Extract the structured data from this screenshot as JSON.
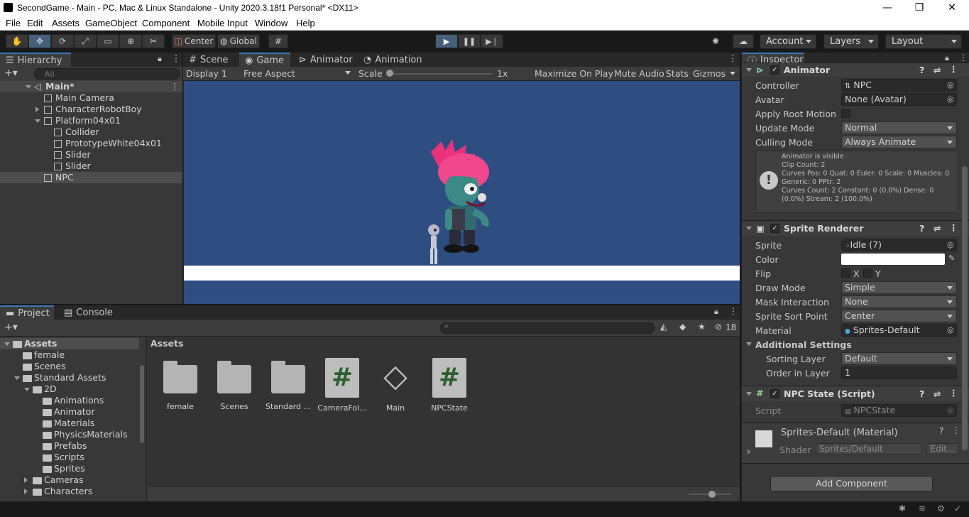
{
  "window": {
    "title": "SecondGame - Main - PC, Mac & Linux Standalone - Unity 2020.3.18f1 Personal* <DX11>",
    "minimize": "—",
    "maximize": "❐",
    "close": "✕"
  },
  "menu": [
    "File",
    "Edit",
    "Assets",
    "GameObject",
    "Component",
    "Mobile Input",
    "Window",
    "Help"
  ],
  "toolbar": {
    "pivot": "Center",
    "space": "Global",
    "account": "Account",
    "layers": "Layers",
    "layout": "Layout"
  },
  "hierarchy": {
    "tab": "Hierarchy",
    "search_placeholder": "All",
    "items": [
      {
        "label": "Main*"
      },
      {
        "label": "Main Camera"
      },
      {
        "label": "CharacterRobotBoy"
      },
      {
        "label": "Platform04x01"
      },
      {
        "label": "Collider"
      },
      {
        "label": "PrototypeWhite04x01"
      },
      {
        "label": "Slider"
      },
      {
        "label": "Slider"
      },
      {
        "label": "NPC"
      }
    ]
  },
  "game_tabs": {
    "scene": "Scene",
    "game": "Game",
    "animator": "Animator",
    "animation": "Animation"
  },
  "game_bar": {
    "display": "Display 1",
    "aspect": "Free Aspect",
    "scale_label": "Scale",
    "scale_value": "1x",
    "maximize": "Maximize On Play",
    "mute": "Mute Audio",
    "stats": "Stats",
    "gizmos": "Gizmos"
  },
  "project": {
    "tab_project": "Project",
    "tab_console": "Console",
    "hidden_count": "18",
    "breadcrumb": "Assets",
    "tree": [
      {
        "label": "Assets"
      },
      {
        "label": "female"
      },
      {
        "label": "Scenes"
      },
      {
        "label": "Standard Assets"
      },
      {
        "label": "2D"
      },
      {
        "label": "Animations"
      },
      {
        "label": "Animator"
      },
      {
        "label": "Materials"
      },
      {
        "label": "PhysicsMaterials"
      },
      {
        "label": "Prefabs"
      },
      {
        "label": "Scripts"
      },
      {
        "label": "Sprites"
      },
      {
        "label": "Cameras"
      },
      {
        "label": "Characters"
      }
    ],
    "assets": [
      {
        "label": "female",
        "kind": "folder"
      },
      {
        "label": "Scenes",
        "kind": "folder"
      },
      {
        "label": "Standard ...",
        "kind": "folder"
      },
      {
        "label": "CameraFol...",
        "kind": "script"
      },
      {
        "label": "Main",
        "kind": "unity-scene"
      },
      {
        "label": "NPCState",
        "kind": "script"
      }
    ]
  },
  "inspector": {
    "tab": "Inspector",
    "animator": {
      "header": "Animator",
      "controller_label": "Controller",
      "controller_value": "NPC",
      "avatar_label": "Avatar",
      "avatar_value": "None (Avatar)",
      "root_motion_label": "Apply Root Motion",
      "update_mode_label": "Update Mode",
      "update_mode_value": "Normal",
      "culling_label": "Culling Mode",
      "culling_value": "Always Animate",
      "info": [
        "Animator is visible",
        "Clip Count: 2",
        "Curves Pos: 0 Quat: 0 Euler: 0 Scale: 0 Muscles: 0",
        "Generic: 0 PPtr: 2",
        "Curves Count: 2 Constant: 0 (0.0%) Dense: 0",
        "(0.0%) Stream: 2 (100.0%)"
      ]
    },
    "sprite_renderer": {
      "header": "Sprite Renderer",
      "sprite_label": "Sprite",
      "sprite_value": "Idle (7)",
      "color_label": "Color",
      "color_value": "#ffffff",
      "flip_label": "Flip",
      "flip_x": "X",
      "flip_y": "Y",
      "draw_mode_label": "Draw Mode",
      "draw_mode_value": "Simple",
      "mask_label": "Mask Interaction",
      "mask_value": "None",
      "sort_point_label": "Sprite Sort Point",
      "sort_point_value": "Center",
      "material_label": "Material",
      "material_value": "Sprites-Default",
      "additional": "Additional Settings",
      "sorting_layer_label": "Sorting Layer",
      "sorting_layer_value": "Default",
      "order_label": "Order in Layer",
      "order_value": "1"
    },
    "npc_state": {
      "header": "NPC State (Script)",
      "script_label": "Script",
      "script_value": "NPCState"
    },
    "material": {
      "title": "Sprites-Default (Material)",
      "shader_label": "Shader",
      "shader_value": "Sprites/Default",
      "edit": "Edit..."
    },
    "add_component": "Add Component"
  },
  "colors": {
    "game_background": "#2e4e82",
    "platform": "#ffffff",
    "accent": "#3a79bb"
  }
}
